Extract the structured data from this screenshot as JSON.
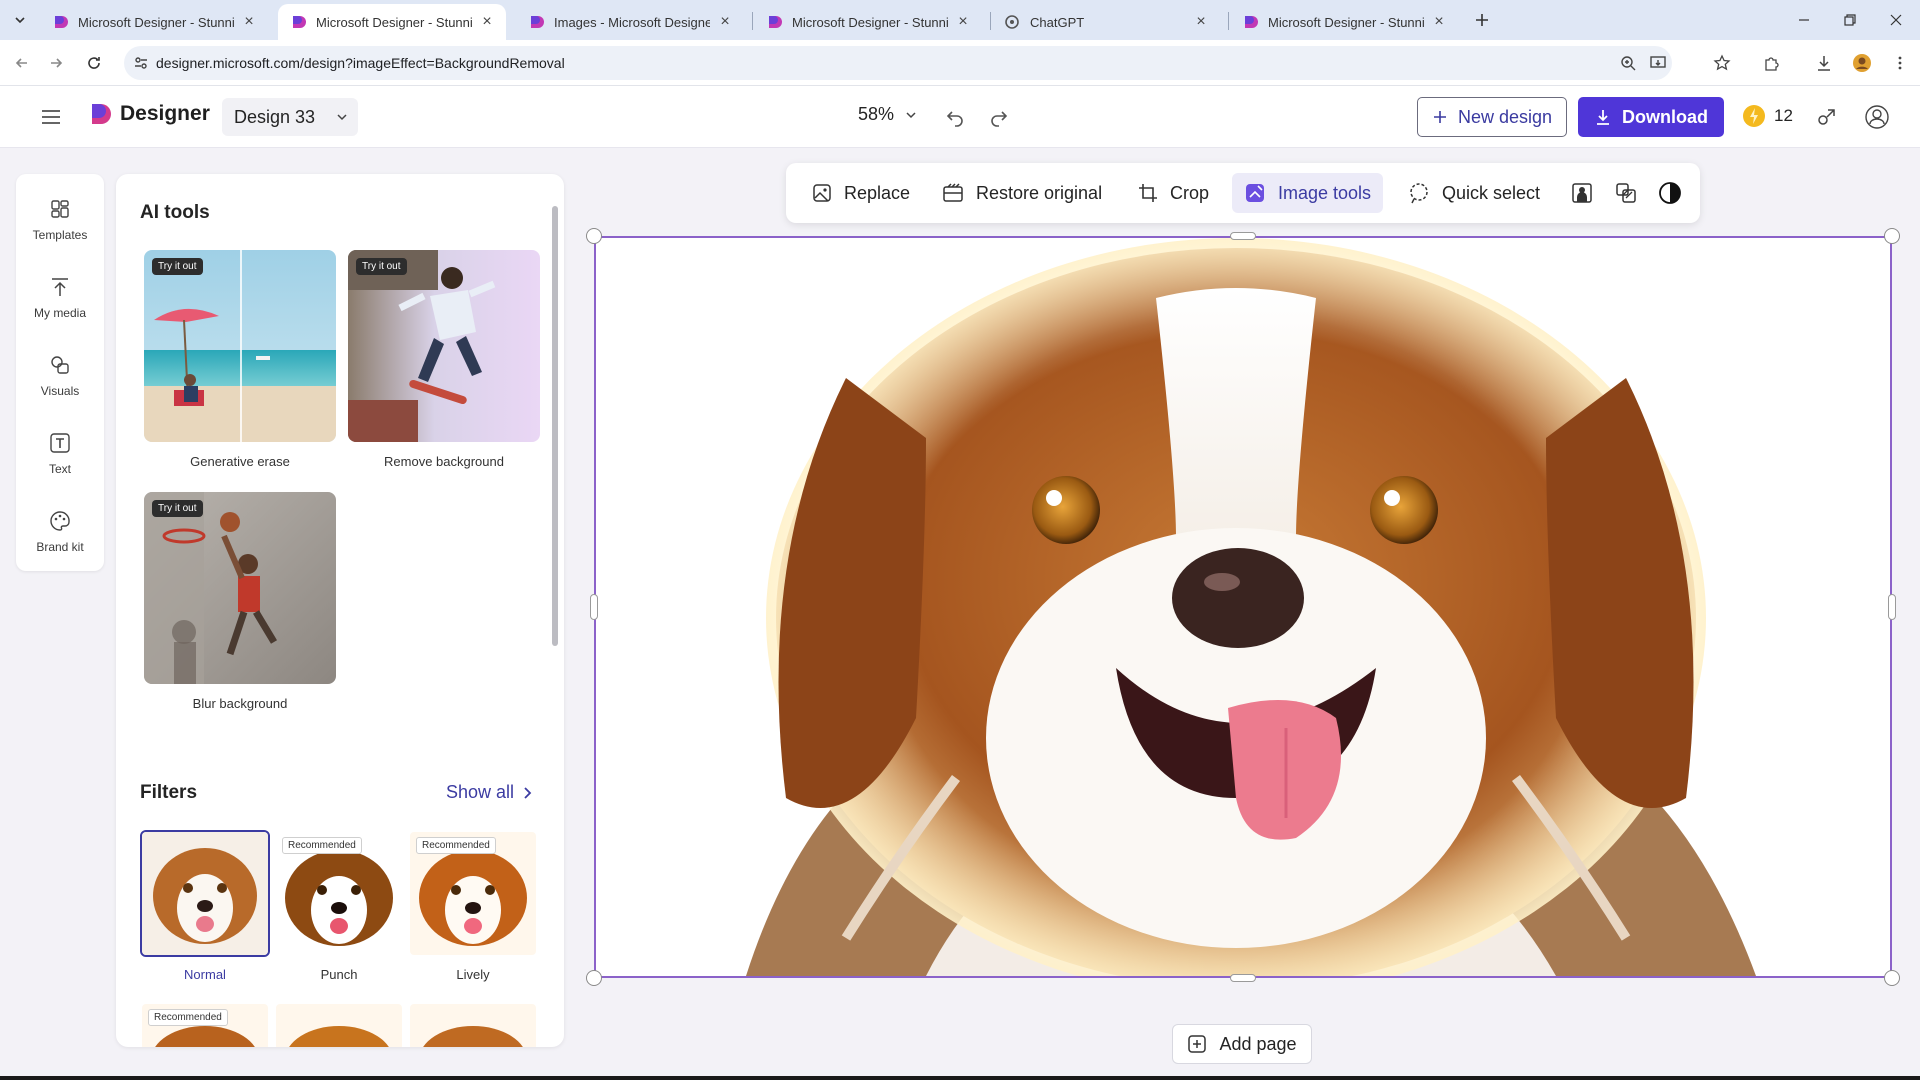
{
  "browser": {
    "tabs": [
      {
        "title": "Microsoft Designer - Stunning designs in a flash",
        "active": false,
        "icon": "designer-favicon"
      },
      {
        "title": "Microsoft Designer - Stunning designs in a flash",
        "active": true,
        "icon": "designer-favicon"
      },
      {
        "title": "Images - Microsoft Designer",
        "active": false,
        "icon": "designer-favicon"
      },
      {
        "title": "Microsoft Designer - Stunning designs in a flash",
        "active": false,
        "icon": "designer-favicon"
      },
      {
        "title": "ChatGPT",
        "active": false,
        "icon": "chatgpt-favicon"
      },
      {
        "title": "Microsoft Designer - Stunning designs in a flash",
        "active": false,
        "icon": "designer-favicon"
      }
    ],
    "url": "designer.microsoft.com/design?imageEffect=BackgroundRemoval"
  },
  "header": {
    "brand": "Designer",
    "design_name": "Design 33",
    "zoom": "58%",
    "new_design_label": "New design",
    "download_label": "Download",
    "credits": "12"
  },
  "rail": {
    "items": [
      {
        "label": "Templates",
        "icon": "templates-icon"
      },
      {
        "label": "My media",
        "icon": "upload-icon"
      },
      {
        "label": "Visuals",
        "icon": "visuals-icon"
      },
      {
        "label": "Text",
        "icon": "text-icon"
      },
      {
        "label": "Brand kit",
        "icon": "palette-icon"
      }
    ]
  },
  "panel": {
    "ai_tools_title": "AI tools",
    "try_badge": "Try it out",
    "tools": [
      {
        "label": "Generative erase"
      },
      {
        "label": "Remove background"
      },
      {
        "label": "Blur background"
      }
    ],
    "filters_title": "Filters",
    "show_all_label": "Show all",
    "recommended_badge": "Recommended",
    "filters": [
      {
        "label": "Normal",
        "selected": true
      },
      {
        "label": "Punch",
        "recommended": true
      },
      {
        "label": "Lively",
        "recommended": true
      }
    ]
  },
  "toolbar": {
    "replace": "Replace",
    "restore": "Restore original",
    "crop": "Crop",
    "image_tools": "Image tools",
    "quick_select": "Quick select"
  },
  "canvas": {
    "add_page_label": "Add page"
  },
  "colors": {
    "accent": "#4f36d8",
    "selection": "#8b62c9",
    "link": "#3b3ba2"
  }
}
